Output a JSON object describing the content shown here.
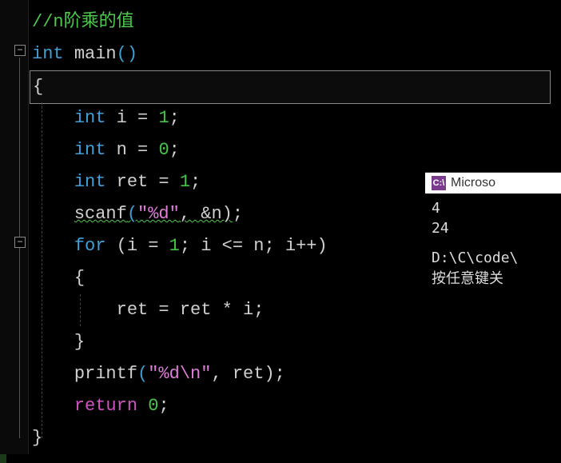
{
  "code": {
    "comment": "//n阶乘的值",
    "l2_int": "int ",
    "l2_main": "main",
    "l2_parens": "()",
    "l3_brace": "{",
    "l4": "    int i = 1;",
    "l4_kw": "int",
    "l4_rest": " i = ",
    "l4_num": "1",
    "l4_semi": ";",
    "l5_kw": "int",
    "l5_rest": " n = ",
    "l5_num": "0",
    "l5_semi": ";",
    "l6_kw": "int",
    "l6_rest": " ret = ",
    "l6_num": "1",
    "l6_semi": ";",
    "l7_scanf": "scanf",
    "l7_open": "(",
    "l7_str": "\"%d\"",
    "l7_rest": ", &n)",
    "l7_semi": ";",
    "l8_for": "for",
    "l8_open": " (i = ",
    "l8_n1": "1",
    "l8_mid": "; i <= n; i++)",
    "l9_brace": "{",
    "l10_body": "ret = ret * i;",
    "l11_brace": "}",
    "l12_printf": "printf",
    "l12_open": "(",
    "l12_str": "\"%d\\n\"",
    "l12_rest": ", ret);",
    "l13_return": "return",
    "l13_sp": " ",
    "l13_num": "0",
    "l13_semi": ";",
    "l14_brace": "}"
  },
  "console": {
    "title": "Microso",
    "out1": "4",
    "out2": "24",
    "out3": "D:\\C\\code\\",
    "out4": "按任意键关"
  },
  "fold": {
    "minus": "−"
  }
}
